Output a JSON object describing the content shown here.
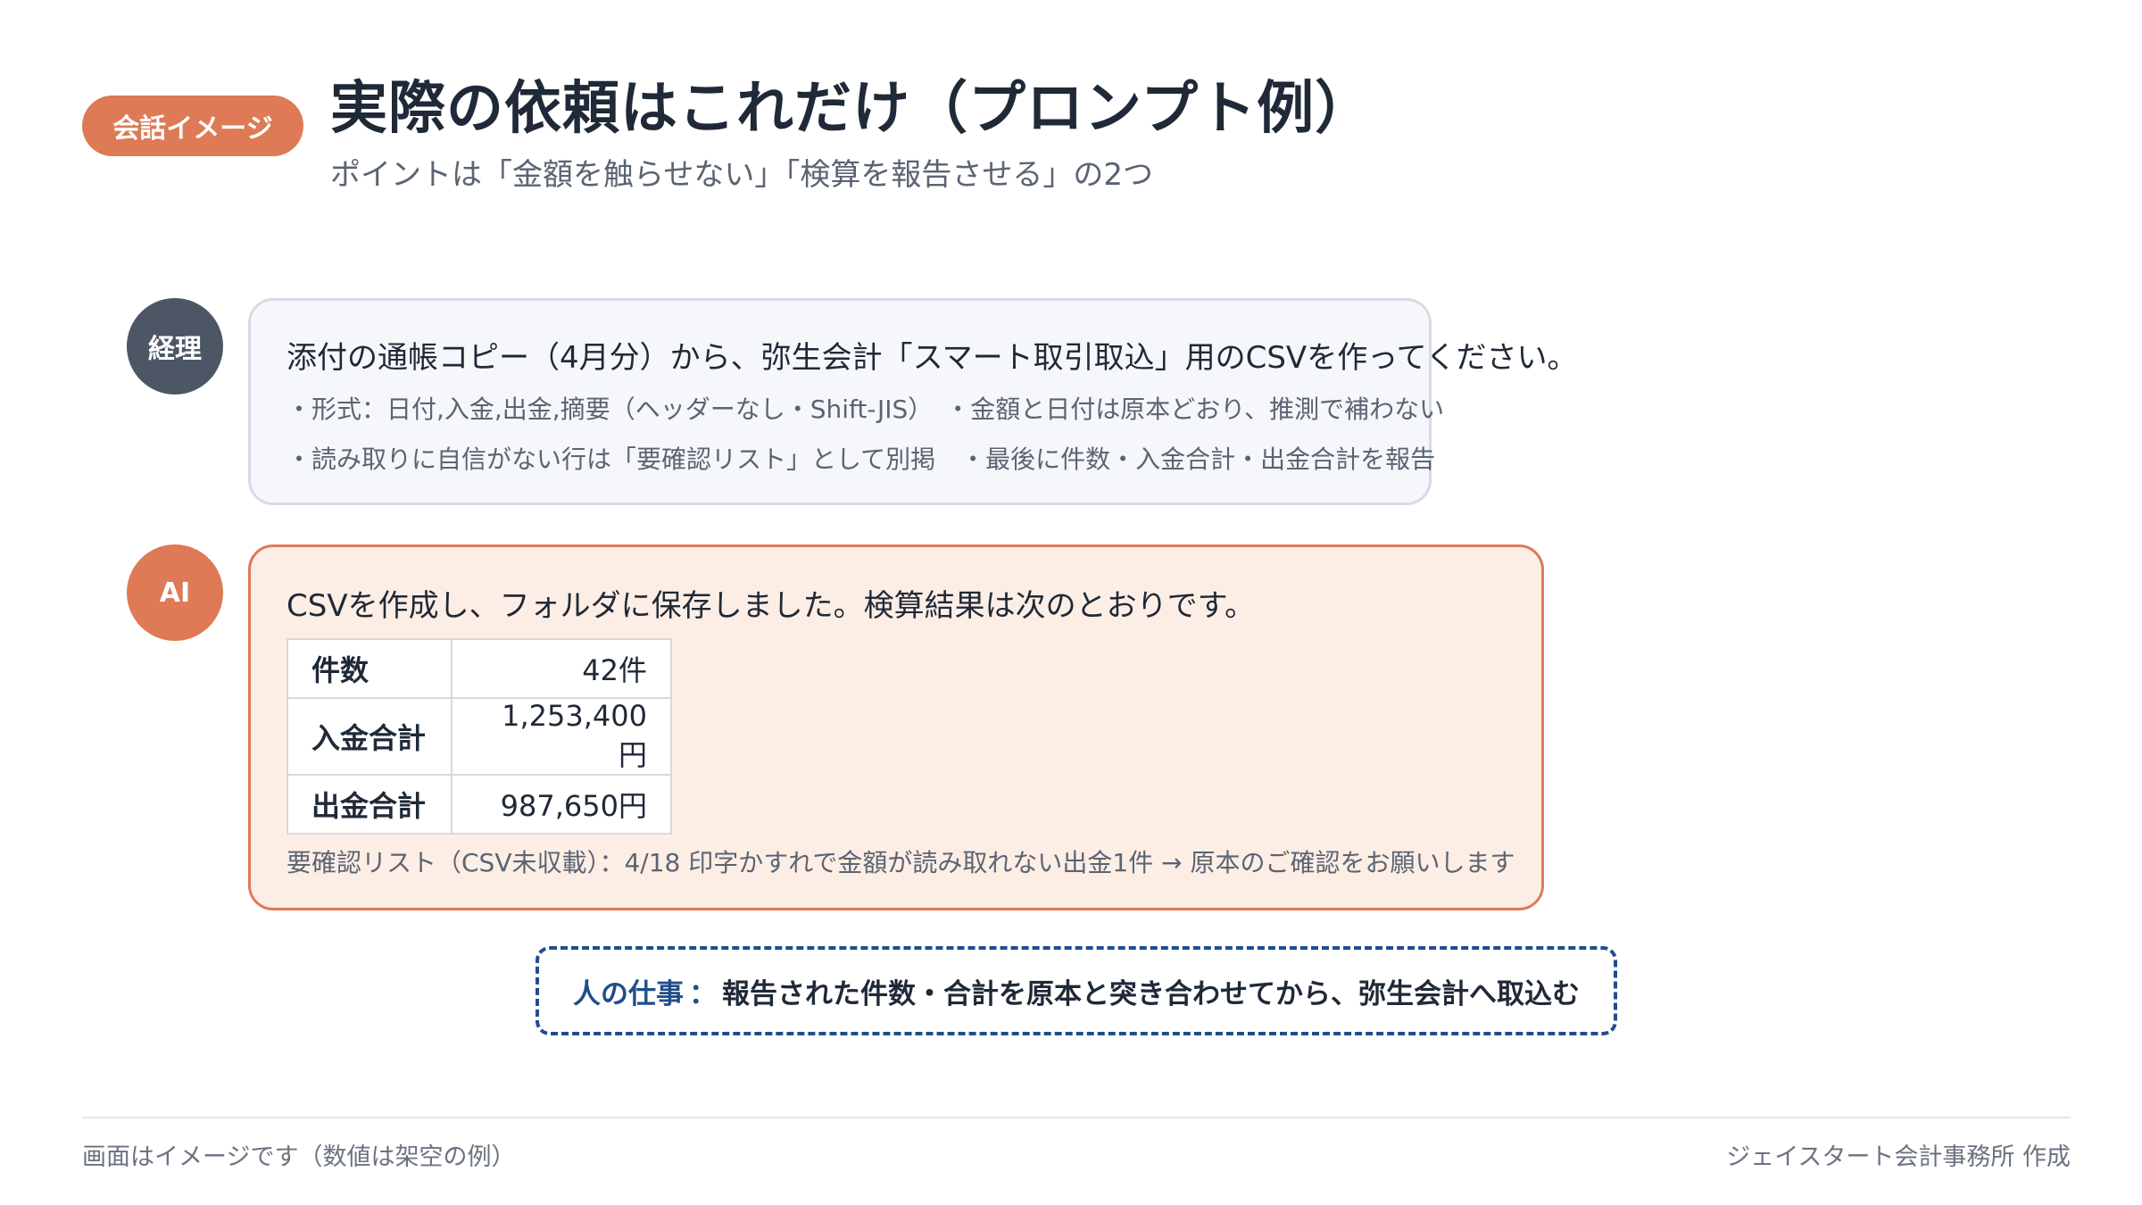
{
  "header": {
    "badge": "会話イメージ",
    "title": "実際の依頼はこれだけ（プロンプト例）",
    "subtitle": "ポイントは「金額を触らせない」「検算を報告させる」の2つ"
  },
  "user_message": {
    "avatar_label": "経理",
    "main": "添付の通帳コピー（4月分）から、弥生会計「スマート取引取込」用のCSVを作ってください。",
    "line2": "・形式：日付,入金,出金,摘要（ヘッダーなし・Shift-JIS）　・金額と日付は原本どおり、推測で補わない",
    "line3": "・読み取りに自信がない行は「要確認リスト」として別掲　・最後に件数・入金合計・出金合計を報告"
  },
  "ai_message": {
    "avatar_label": "AI",
    "intro": "CSVを作成し、フォルダに保存しました。検算結果は次のとおりです。",
    "table": [
      {
        "label": "件数",
        "value": "42件"
      },
      {
        "label": "入金合計",
        "value": "1,253,400円"
      },
      {
        "label": "出金合計",
        "value": "987,650円"
      }
    ],
    "note": "要確認リスト（CSV未収載）：4/18 印字かすれで金額が読み取れない出金1件 → 原本のご確認をお願いします"
  },
  "human_task": {
    "label": "人の仕事",
    "separator": "：",
    "text": "報告された件数・合計を原本と突き合わせてから、弥生会計へ取込む"
  },
  "footer": {
    "left": "画面はイメージです（数値は架空の例）",
    "right": "ジェイスタート会計事務所 作成"
  },
  "colors": {
    "accent_orange": "#de7a55",
    "avatar_gray": "#4d5665",
    "task_blue": "#1e4e8c",
    "ai_bubble_bg": "#fdeee5",
    "user_bubble_bg": "#f5f7fa"
  }
}
